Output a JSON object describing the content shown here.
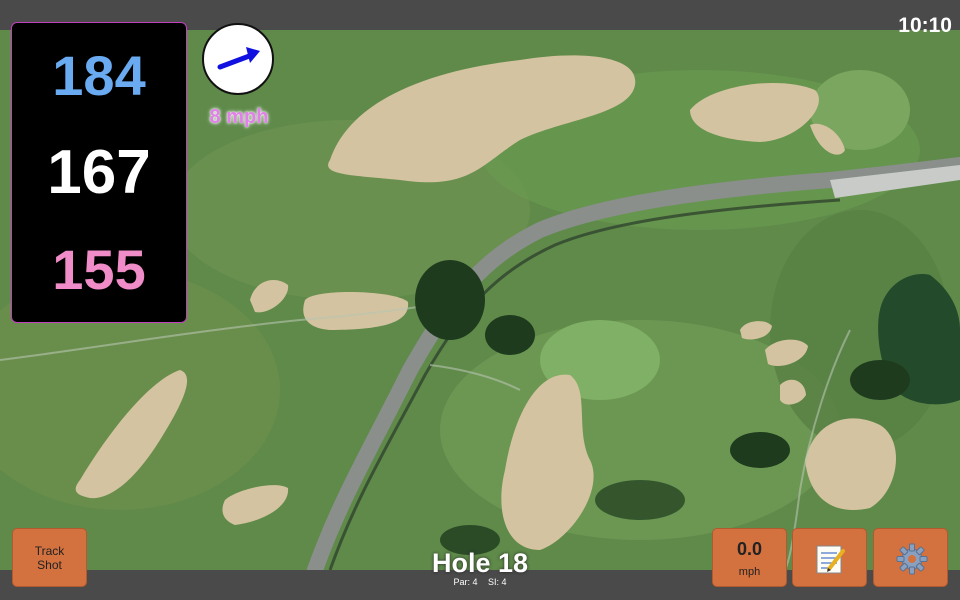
{
  "status": {
    "time": "10:10"
  },
  "distances": {
    "back": "184",
    "center": "167",
    "front": "155"
  },
  "wind": {
    "speed_label": "8 mph",
    "direction": "east-northeast"
  },
  "hole": {
    "title": "Hole 18",
    "par_label": "Par: 4",
    "si_label": "SI: 4"
  },
  "buttons": {
    "track_shot": "Track\nShot",
    "speed_value": "0.0",
    "speed_unit": "mph",
    "notes_icon": "notepad-icon",
    "settings_icon": "gear-icon"
  },
  "colors": {
    "back_distance": "#6aaaf0",
    "center_distance": "#ffffff",
    "front_distance": "#f08cc8",
    "button": "#d3713f",
    "wind_arrow": "#1010e0"
  }
}
